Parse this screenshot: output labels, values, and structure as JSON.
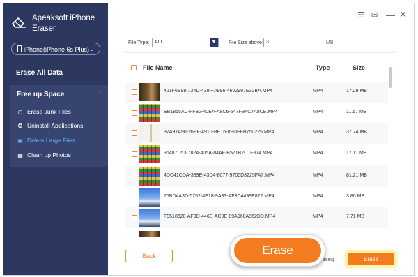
{
  "app": {
    "title": "Apeaksoft iPhone Eraser",
    "device": "iPhone(iPhone 6s Plus)"
  },
  "sidebar": {
    "erase_all": "Erase All Data",
    "free_up_space": "Free up Space",
    "items": [
      {
        "label": "Erase Junk Files",
        "icon": "clock-icon"
      },
      {
        "label": "Uninstall Applications",
        "icon": "apps-icon"
      },
      {
        "label": "Delete Large Files",
        "icon": "file-icon",
        "active": true
      },
      {
        "label": "Clean up Photos",
        "icon": "photo-icon"
      }
    ]
  },
  "filters": {
    "file_type_label": "File Type:",
    "file_type_value": "ALL",
    "file_size_label": "File Size above:",
    "file_size_value": "3",
    "unit": "MB"
  },
  "table": {
    "headers": {
      "name": "File Name",
      "type": "Type",
      "size": "Size"
    },
    "rows": [
      {
        "name": "421F6B99-134D-438F-A996-4602997E32BA.MP4",
        "type": "MP4",
        "size": "17.29 MB"
      },
      {
        "name": "EB1855AC-FFB2-40EA-A8C6-547FB4C7A8CE.MP4",
        "type": "MP4",
        "size": "11.67 MB"
      },
      {
        "name": "37A97A90-26EF-4910-BE16-8EDEFB750225.MP4",
        "type": "MP4",
        "size": "37.74 MB"
      },
      {
        "name": "36487D53-7824-405A-84AF-B571B2C1F374.MP4",
        "type": "MP4",
        "size": "17.11 MB"
      },
      {
        "name": "4DC41CDA-389E-43D4-8077-9705D3225FA7.MP4",
        "type": "MP4",
        "size": "81.21 MB"
      },
      {
        "name": "75BD4A3D-5252-4E18-9A33-AF3C4499E872.MP4",
        "type": "MP4",
        "size": "3.80 MB"
      },
      {
        "name": "F9518620-AF0D-446E-AC9E-89A960A862DD.MP4",
        "type": "MP4",
        "size": "7.71 MB"
      }
    ]
  },
  "footer": {
    "back_label": "Back",
    "before_erasing": "ore Erasing",
    "erase_label": "Erase",
    "erase_callout_label": "Erase"
  }
}
